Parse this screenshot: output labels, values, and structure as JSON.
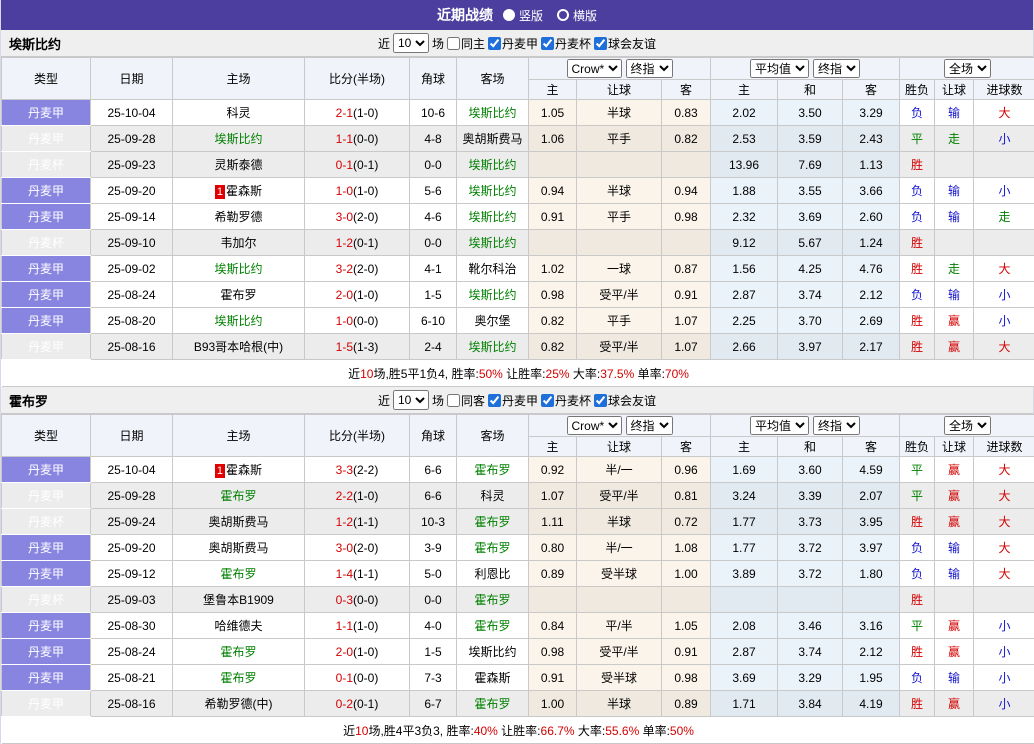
{
  "ui": {
    "title": "近期战绩",
    "radios": [
      {
        "label": "竖版",
        "selected": true
      },
      {
        "label": "横版",
        "selected": false
      }
    ],
    "filter": {
      "near": "近",
      "count": "10",
      "matches": "场",
      "leagues": [
        {
          "label": "丹麦甲",
          "checked": true
        },
        {
          "label": "丹麦杯",
          "checked": true
        },
        {
          "label": "球会友谊",
          "checked": true
        }
      ]
    },
    "header": {
      "cols": [
        "类型",
        "日期",
        "主场",
        "比分(半场)",
        "角球",
        "客场"
      ],
      "selects": {
        "crow": "Crow*",
        "final1": "终指",
        "avg": "平均值",
        "final2": "终指",
        "scope": "全场"
      },
      "sub": [
        "主",
        "让球",
        "客",
        "主",
        "和",
        "客",
        "胜负",
        "让球",
        "进球数"
      ]
    }
  },
  "colors": {
    "bar_purple": "#4b3e9e",
    "league_cell": "#8885e0",
    "cup_cell": "#9a99c6",
    "win_red": "#d40000",
    "draw_green": "#008000",
    "lose_blue": "#1414cc"
  },
  "tables": [
    {
      "team": "埃斯比约",
      "same_label": "同主",
      "rows": [
        {
          "lg": "丹麦甲",
          "cup": false,
          "shade": false,
          "date": "25-10-04",
          "badge": "",
          "home": "科灵",
          "hg": false,
          "score": "2-1",
          "half": "(1-0)",
          "corner": "10-6",
          "away": "埃斯比约",
          "ag": true,
          "crow": [
            "1.05",
            "半球",
            "0.83"
          ],
          "avg": [
            "2.02",
            "3.50",
            "3.29"
          ],
          "res": [
            [
              "负",
              "b"
            ],
            [
              "输",
              "b"
            ],
            [
              "大",
              "r"
            ]
          ]
        },
        {
          "lg": "丹麦甲",
          "cup": false,
          "shade": true,
          "date": "25-09-28",
          "badge": "",
          "home": "埃斯比约",
          "hg": true,
          "score": "1-1",
          "half": "(0-0)",
          "corner": "4-8",
          "away": "奥胡斯费马",
          "ag": false,
          "crow": [
            "1.06",
            "平手",
            "0.82"
          ],
          "avg": [
            "2.53",
            "3.59",
            "2.43"
          ],
          "res": [
            [
              "平",
              "g"
            ],
            [
              "走",
              "g"
            ],
            [
              "小",
              "b"
            ]
          ]
        },
        {
          "lg": "丹麦杯",
          "cup": true,
          "shade": true,
          "date": "25-09-23",
          "badge": "",
          "home": "灵斯泰德",
          "hg": false,
          "score": "0-1",
          "half": "(0-1)",
          "corner": "0-0",
          "away": "埃斯比约",
          "ag": true,
          "crow": [
            "",
            "",
            ""
          ],
          "avg": [
            "13.96",
            "7.69",
            "1.13"
          ],
          "res": [
            [
              "胜",
              "r"
            ],
            [
              "",
              ""
            ],
            [
              "",
              ""
            ]
          ]
        },
        {
          "lg": "丹麦甲",
          "cup": false,
          "shade": false,
          "date": "25-09-20",
          "badge": "1",
          "home": "霍森斯",
          "hg": false,
          "score": "1-0",
          "half": "(1-0)",
          "corner": "5-6",
          "away": "埃斯比约",
          "ag": true,
          "crow": [
            "0.94",
            "半球",
            "0.94"
          ],
          "avg": [
            "1.88",
            "3.55",
            "3.66"
          ],
          "res": [
            [
              "负",
              "b"
            ],
            [
              "输",
              "b"
            ],
            [
              "小",
              "b"
            ]
          ]
        },
        {
          "lg": "丹麦甲",
          "cup": false,
          "shade": false,
          "date": "25-09-14",
          "badge": "",
          "home": "希勒罗德",
          "hg": false,
          "score": "3-0",
          "half": "(2-0)",
          "corner": "4-6",
          "away": "埃斯比约",
          "ag": true,
          "crow": [
            "0.91",
            "平手",
            "0.98"
          ],
          "avg": [
            "2.32",
            "3.69",
            "2.60"
          ],
          "res": [
            [
              "负",
              "b"
            ],
            [
              "输",
              "b"
            ],
            [
              "走",
              "g"
            ]
          ]
        },
        {
          "lg": "丹麦杯",
          "cup": true,
          "shade": true,
          "date": "25-09-10",
          "badge": "",
          "home": "韦加尔",
          "hg": false,
          "score": "1-2",
          "half": "(0-1)",
          "corner": "0-0",
          "away": "埃斯比约",
          "ag": true,
          "crow": [
            "",
            "",
            ""
          ],
          "avg": [
            "9.12",
            "5.67",
            "1.24"
          ],
          "res": [
            [
              "胜",
              "r"
            ],
            [
              "",
              ""
            ],
            [
              "",
              ""
            ]
          ]
        },
        {
          "lg": "丹麦甲",
          "cup": false,
          "shade": false,
          "date": "25-09-02",
          "badge": "",
          "home": "埃斯比约",
          "hg": true,
          "score": "3-2",
          "half": "(2-0)",
          "corner": "4-1",
          "away": "靴尔科治",
          "ag": false,
          "crow": [
            "1.02",
            "一球",
            "0.87"
          ],
          "avg": [
            "1.56",
            "4.25",
            "4.76"
          ],
          "res": [
            [
              "胜",
              "r"
            ],
            [
              "走",
              "g"
            ],
            [
              "大",
              "r"
            ]
          ]
        },
        {
          "lg": "丹麦甲",
          "cup": false,
          "shade": false,
          "date": "25-08-24",
          "badge": "",
          "home": "霍布罗",
          "hg": false,
          "score": "2-0",
          "half": "(1-0)",
          "corner": "1-5",
          "away": "埃斯比约",
          "ag": true,
          "crow": [
            "0.98",
            "受平/半",
            "0.91"
          ],
          "avg": [
            "2.87",
            "3.74",
            "2.12"
          ],
          "res": [
            [
              "负",
              "b"
            ],
            [
              "输",
              "b"
            ],
            [
              "小",
              "b"
            ]
          ]
        },
        {
          "lg": "丹麦甲",
          "cup": false,
          "shade": false,
          "date": "25-08-20",
          "badge": "",
          "home": "埃斯比约",
          "hg": true,
          "score": "1-0",
          "half": "(0-0)",
          "corner": "6-10",
          "away": "奥尔堡",
          "ag": false,
          "crow": [
            "0.82",
            "平手",
            "1.07"
          ],
          "avg": [
            "2.25",
            "3.70",
            "2.69"
          ],
          "res": [
            [
              "胜",
              "r"
            ],
            [
              "赢",
              "r"
            ],
            [
              "小",
              "b"
            ]
          ]
        },
        {
          "lg": "丹麦甲",
          "cup": false,
          "shade": true,
          "date": "25-08-16",
          "badge": "",
          "home": "B93哥本哈根(中)",
          "hg": false,
          "score": "1-5",
          "half": "(1-3)",
          "corner": "2-4",
          "away": "埃斯比约",
          "ag": true,
          "crow": [
            "0.82",
            "受平/半",
            "1.07"
          ],
          "avg": [
            "2.66",
            "3.97",
            "2.17"
          ],
          "res": [
            [
              "胜",
              "r"
            ],
            [
              "赢",
              "r"
            ],
            [
              "大",
              "r"
            ]
          ]
        }
      ],
      "summary": [
        [
          "近",
          ""
        ],
        [
          "10",
          "r"
        ],
        [
          "场,胜5平1负4, 胜率:",
          ""
        ],
        [
          "50%",
          "r"
        ],
        [
          " 让胜率:",
          ""
        ],
        [
          "25%",
          "r"
        ],
        [
          " 大率:",
          ""
        ],
        [
          "37.5%",
          "r"
        ],
        [
          " 单率:",
          ""
        ],
        [
          "70%",
          "r"
        ]
      ]
    },
    {
      "team": "霍布罗",
      "same_label": "同客",
      "rows": [
        {
          "lg": "丹麦甲",
          "cup": false,
          "shade": false,
          "date": "25-10-04",
          "badge": "1",
          "home": "霍森斯",
          "hg": false,
          "score": "3-3",
          "half": "(2-2)",
          "corner": "6-6",
          "away": "霍布罗",
          "ag": true,
          "crow": [
            "0.92",
            "半/一",
            "0.96"
          ],
          "avg": [
            "1.69",
            "3.60",
            "4.59"
          ],
          "res": [
            [
              "平",
              "g"
            ],
            [
              "赢",
              "r"
            ],
            [
              "大",
              "r"
            ]
          ]
        },
        {
          "lg": "丹麦甲",
          "cup": false,
          "shade": true,
          "date": "25-09-28",
          "badge": "",
          "home": "霍布罗",
          "hg": true,
          "score": "2-2",
          "half": "(1-0)",
          "corner": "6-6",
          "away": "科灵",
          "ag": false,
          "crow": [
            "1.07",
            "受平/半",
            "0.81"
          ],
          "avg": [
            "3.24",
            "3.39",
            "2.07"
          ],
          "res": [
            [
              "平",
              "g"
            ],
            [
              "赢",
              "r"
            ],
            [
              "大",
              "r"
            ]
          ]
        },
        {
          "lg": "丹麦杯",
          "cup": true,
          "shade": true,
          "date": "25-09-24",
          "badge": "",
          "home": "奥胡斯费马",
          "hg": false,
          "score": "1-2",
          "half": "(1-1)",
          "corner": "10-3",
          "away": "霍布罗",
          "ag": true,
          "crow": [
            "1.11",
            "半球",
            "0.72"
          ],
          "avg": [
            "1.77",
            "3.73",
            "3.95"
          ],
          "res": [
            [
              "胜",
              "r"
            ],
            [
              "赢",
              "r"
            ],
            [
              "大",
              "r"
            ]
          ]
        },
        {
          "lg": "丹麦甲",
          "cup": false,
          "shade": false,
          "date": "25-09-20",
          "badge": "",
          "home": "奥胡斯费马",
          "hg": false,
          "score": "3-0",
          "half": "(2-0)",
          "corner": "3-9",
          "away": "霍布罗",
          "ag": true,
          "crow": [
            "0.80",
            "半/一",
            "1.08"
          ],
          "avg": [
            "1.77",
            "3.72",
            "3.97"
          ],
          "res": [
            [
              "负",
              "b"
            ],
            [
              "输",
              "b"
            ],
            [
              "大",
              "r"
            ]
          ]
        },
        {
          "lg": "丹麦甲",
          "cup": false,
          "shade": false,
          "date": "25-09-12",
          "badge": "",
          "home": "霍布罗",
          "hg": true,
          "score": "1-4",
          "half": "(1-1)",
          "corner": "5-0",
          "away": "利恩比",
          "ag": false,
          "crow": [
            "0.89",
            "受半球",
            "1.00"
          ],
          "avg": [
            "3.89",
            "3.72",
            "1.80"
          ],
          "res": [
            [
              "负",
              "b"
            ],
            [
              "输",
              "b"
            ],
            [
              "大",
              "r"
            ]
          ]
        },
        {
          "lg": "丹麦杯",
          "cup": true,
          "shade": true,
          "date": "25-09-03",
          "badge": "",
          "home": "堡鲁本B1909",
          "hg": false,
          "score": "0-3",
          "half": "(0-0)",
          "corner": "0-0",
          "away": "霍布罗",
          "ag": true,
          "crow": [
            "",
            "",
            ""
          ],
          "avg": [
            "",
            "",
            ""
          ],
          "res": [
            [
              "胜",
              "r"
            ],
            [
              "",
              ""
            ],
            [
              "",
              ""
            ]
          ]
        },
        {
          "lg": "丹麦甲",
          "cup": false,
          "shade": false,
          "date": "25-08-30",
          "badge": "",
          "home": "哈维德夫",
          "hg": false,
          "score": "1-1",
          "half": "(1-0)",
          "corner": "4-0",
          "away": "霍布罗",
          "ag": true,
          "crow": [
            "0.84",
            "平/半",
            "1.05"
          ],
          "avg": [
            "2.08",
            "3.46",
            "3.16"
          ],
          "res": [
            [
              "平",
              "g"
            ],
            [
              "赢",
              "r"
            ],
            [
              "小",
              "b"
            ]
          ]
        },
        {
          "lg": "丹麦甲",
          "cup": false,
          "shade": false,
          "date": "25-08-24",
          "badge": "",
          "home": "霍布罗",
          "hg": true,
          "score": "2-0",
          "half": "(1-0)",
          "corner": "1-5",
          "away": "埃斯比约",
          "ag": false,
          "crow": [
            "0.98",
            "受平/半",
            "0.91"
          ],
          "avg": [
            "2.87",
            "3.74",
            "2.12"
          ],
          "res": [
            [
              "胜",
              "r"
            ],
            [
              "赢",
              "r"
            ],
            [
              "小",
              "b"
            ]
          ]
        },
        {
          "lg": "丹麦甲",
          "cup": false,
          "shade": false,
          "date": "25-08-21",
          "badge": "",
          "home": "霍布罗",
          "hg": true,
          "score": "0-1",
          "half": "(0-0)",
          "corner": "7-3",
          "away": "霍森斯",
          "ag": false,
          "crow": [
            "0.91",
            "受半球",
            "0.98"
          ],
          "avg": [
            "3.69",
            "3.29",
            "1.95"
          ],
          "res": [
            [
              "负",
              "b"
            ],
            [
              "输",
              "b"
            ],
            [
              "小",
              "b"
            ]
          ]
        },
        {
          "lg": "丹麦甲",
          "cup": false,
          "shade": true,
          "date": "25-08-16",
          "badge": "",
          "home": "希勒罗德(中)",
          "hg": false,
          "score": "0-2",
          "half": "(0-1)",
          "corner": "6-7",
          "away": "霍布罗",
          "ag": true,
          "crow": [
            "1.00",
            "半球",
            "0.89"
          ],
          "avg": [
            "1.71",
            "3.84",
            "4.19"
          ],
          "res": [
            [
              "胜",
              "r"
            ],
            [
              "赢",
              "r"
            ],
            [
              "小",
              "b"
            ]
          ]
        }
      ],
      "summary": [
        [
          "近",
          ""
        ],
        [
          "10",
          "r"
        ],
        [
          "场,胜4平3负3, 胜率:",
          ""
        ],
        [
          "40%",
          "r"
        ],
        [
          " 让胜率:",
          ""
        ],
        [
          "66.7%",
          "r"
        ],
        [
          " 大率:",
          ""
        ],
        [
          "55.6%",
          "r"
        ],
        [
          " 单率:",
          ""
        ],
        [
          "50%",
          "r"
        ]
      ]
    }
  ]
}
